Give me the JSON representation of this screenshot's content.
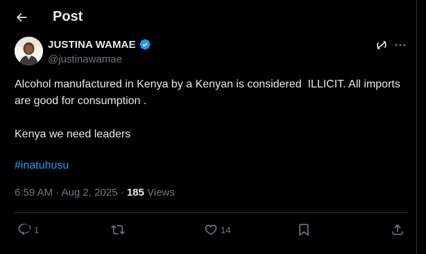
{
  "header": {
    "title": "Post",
    "back_icon": "arrow-left-icon"
  },
  "author": {
    "display_name": "JUSTINA WAMAE",
    "handle": "@justinawamae",
    "verified_color": "#1d9bf0",
    "avatar": "profile-photo"
  },
  "tweet": {
    "line1": "Alcohol manufactured in Kenya by a Kenyan is considered  ILLICIT. All imports are good for consumption .",
    "line2": "Kenya we need leaders",
    "hashtag": "#inatuhusu"
  },
  "meta": {
    "time": "6:59 AM",
    "separator1": " · ",
    "date": "Aug 2, 2025",
    "separator2": " · ",
    "views_count": "185",
    "views_label": " Views"
  },
  "actions": {
    "replies": "1",
    "reposts": "",
    "likes": "14"
  },
  "colors": {
    "background": "#000000",
    "text": "#e7e9ea",
    "muted": "#71767b",
    "accent": "#1d9bf0",
    "border": "#2f3336"
  }
}
